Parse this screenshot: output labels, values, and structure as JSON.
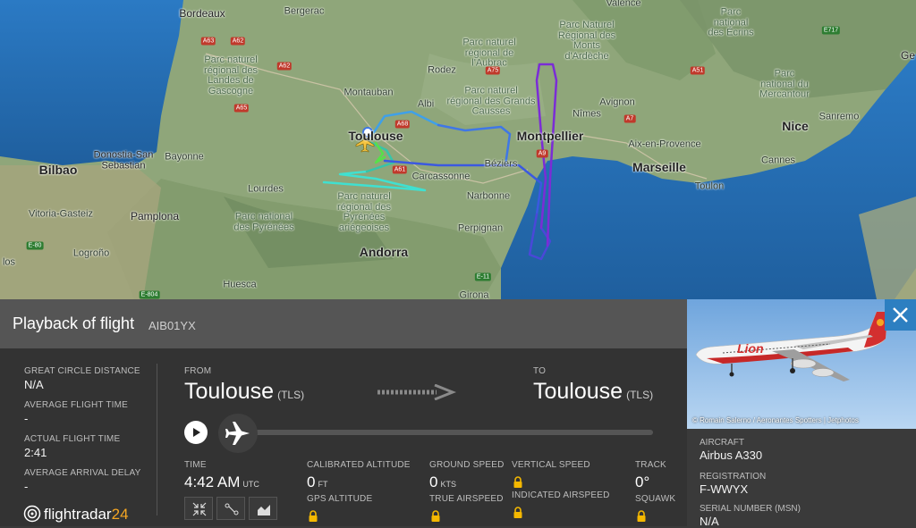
{
  "map": {
    "labels": {
      "bordeaux": "Bordeaux",
      "bergerac": "Bergerac",
      "valence": "Valence",
      "gap": "Ge",
      "montauban": "Montauban",
      "albi": "Albi",
      "rodez": "Rodez",
      "toulouse": "Toulouse",
      "carcassonne": "Carcassonne",
      "narbonne": "Narbonne",
      "beziers": "Béziers",
      "montpellier": "Montpellier",
      "nimes": "Nîmes",
      "avignon": "Avignon",
      "aix": "Aix-en-Provence",
      "marseille": "Marseille",
      "toulon": "Toulon",
      "nice": "Nice",
      "cannes": "Cannes",
      "sanremo": "Sanremo",
      "perpignan": "Perpignan",
      "girona": "Girona",
      "andorra": "Andorra",
      "lourdes": "Lourdes",
      "bayonne": "Bayonne",
      "bilbao": "Bilbao",
      "donostia": "Donostia-San\nSebastian",
      "vitoria": "Vitoria-Gasteiz",
      "pamplona": "Pamplona",
      "logrono": "Logroño",
      "huesca": "Huesca",
      "los": "los",
      "park_landes": "Parc naturel\nrégional des\nLandes de\nGascogne",
      "park_aubrac": "Parc naturel\nrégional de\nl'Aubrac",
      "park_causses": "Parc naturel\nrégional des Grands\nCausses",
      "park_ardeche": "Parc Naturel\nRégional des\nMonts\nd'Ardèche",
      "park_ecrins": "Parc\nnational\ndes Écrins",
      "park_mercantour": "Parc\nnational du\nMercantour",
      "park_pyrenees": "Parc national\ndes Pyrénées",
      "park_pyrenees_ar": "Parc naturel\nrégional des\nPyrénées\nariégeoises"
    },
    "highways": [
      "A63",
      "A62",
      "A62",
      "A65",
      "A68",
      "A61",
      "A75",
      "A9",
      "A7",
      "A51",
      "E717",
      "E-80",
      "E-11",
      "E-804"
    ]
  },
  "header": {
    "title": "Playback of flight",
    "flight_id": "AIB01YX"
  },
  "stats": {
    "gcd_label": "GREAT CIRCLE DISTANCE",
    "gcd_value": "N/A",
    "aft_label": "AVERAGE FLIGHT TIME",
    "aft_value": "-",
    "act_label": "ACTUAL FLIGHT TIME",
    "act_value": "2:41",
    "aad_label": "AVERAGE ARRIVAL DELAY",
    "aad_value": "-"
  },
  "route": {
    "from_label": "FROM",
    "from_city": "Toulouse",
    "from_code": "(TLS)",
    "to_label": "TO",
    "to_city": "Toulouse",
    "to_code": "(TLS)"
  },
  "telemetry": {
    "time_label": "TIME",
    "time_value": "4:42 AM",
    "time_unit": "UTC",
    "cal_alt_label": "CALIBRATED ALTITUDE",
    "cal_alt_value": "0",
    "cal_alt_unit": "FT",
    "gps_alt_label": "GPS ALTITUDE",
    "gs_label": "GROUND SPEED",
    "gs_value": "0",
    "gs_unit": "KTS",
    "tas_label": "TRUE AIRSPEED",
    "vs_label": "VERTICAL SPEED",
    "ias_label": "INDICATED AIRSPEED",
    "track_label": "TRACK",
    "track_value": "0°",
    "squawk_label": "SQUAWK"
  },
  "logo": {
    "text": "flightradar",
    "num": "24"
  },
  "aircraft": {
    "photo_credit": "© Romain Salerno / Aeronantes Spotters | Jetphotos",
    "livery_text": "Lion",
    "type_label": "AIRCRAFT",
    "type_value": "Airbus A330",
    "reg_label": "REGISTRATION",
    "reg_value": "F-WWYX",
    "msn_label": "SERIAL NUMBER (MSN)",
    "msn_value": "N/A"
  },
  "colors": {
    "accent": "#2d7fc1",
    "logo_num": "#f5a623",
    "track_start": "#40e0d0",
    "track_end": "#7b2cd6"
  }
}
